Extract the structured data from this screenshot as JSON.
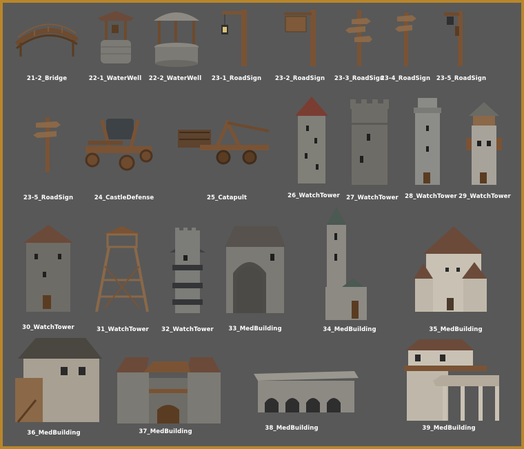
{
  "assets": [
    {
      "label": "21-2_Bridge",
      "kind": "bridge"
    },
    {
      "label": "22-1_WaterWell",
      "kind": "water-well"
    },
    {
      "label": "22-2_WaterWell",
      "kind": "water-well"
    },
    {
      "label": "23-1_RoadSign",
      "kind": "road-sign"
    },
    {
      "label": "23-2_RoadSign",
      "kind": "road-sign"
    },
    {
      "label": "23-3_RoadSign",
      "kind": "road-sign"
    },
    {
      "label": "23-4_RoadSign",
      "kind": "road-sign"
    },
    {
      "label": "23-5_RoadSign",
      "kind": "road-sign"
    },
    {
      "label": "23-5_RoadSign",
      "kind": "road-sign"
    },
    {
      "label": "24_CastleDefense",
      "kind": "castle-defense"
    },
    {
      "label": "25_Catapult",
      "kind": "catapult"
    },
    {
      "label": "26_WatchTower",
      "kind": "watch-tower"
    },
    {
      "label": "27_WatchTower",
      "kind": "watch-tower"
    },
    {
      "label": "28_WatchTower",
      "kind": "watch-tower"
    },
    {
      "label": "29_WatchTower",
      "kind": "watch-tower"
    },
    {
      "label": "30_WatchTower",
      "kind": "watch-tower"
    },
    {
      "label": "31_WatchTower",
      "kind": "watch-tower"
    },
    {
      "label": "32_WatchTower",
      "kind": "watch-tower"
    },
    {
      "label": "33_MedBuilding",
      "kind": "medieval-building"
    },
    {
      "label": "34_MedBuilding",
      "kind": "medieval-building"
    },
    {
      "label": "35_MedBuilding",
      "kind": "medieval-building"
    },
    {
      "label": "36_MedBuilding",
      "kind": "medieval-building"
    },
    {
      "label": "37_MedBuilding",
      "kind": "medieval-building"
    },
    {
      "label": "38_MedBuilding",
      "kind": "medieval-building"
    },
    {
      "label": "39_MedBuilding",
      "kind": "medieval-building"
    }
  ],
  "colors": {
    "frame": "#b8862b",
    "background": "#585858",
    "caption": "#ffffff",
    "wood": "#7a5334",
    "stone": "#8a8a86",
    "roof": "#6b4a3a"
  }
}
